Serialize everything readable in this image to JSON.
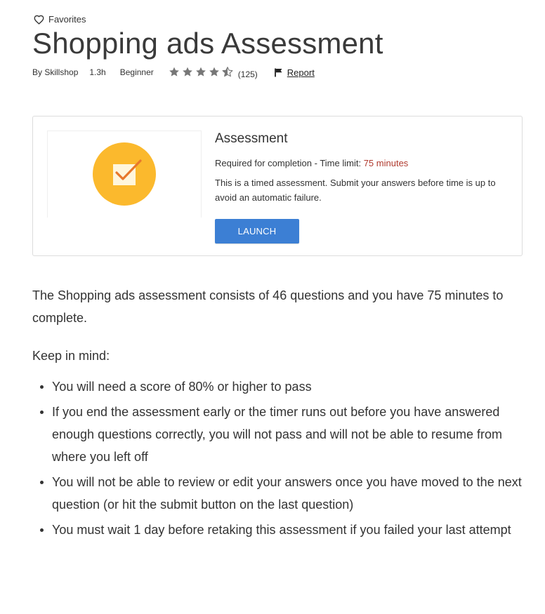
{
  "favorites": {
    "label": "Favorites",
    "icon": "heart-outline-icon"
  },
  "header": {
    "title": "Shopping ads Assessment",
    "author": "By Skillshop",
    "duration": "1.3h",
    "level": "Beginner",
    "rating": 4.5,
    "rating_max": 5,
    "rating_count": "(125)",
    "report_label": "Report",
    "report_icon": "flag-icon"
  },
  "card": {
    "icon": "checkbox-badge-icon",
    "icon_colors": {
      "circle": "#FBB92D",
      "box": "#FFF6DC",
      "check": "#E8782B"
    },
    "title": "Assessment",
    "requirement_text": "Required for completion - Time limit:",
    "time_limit": "75 minutes",
    "description": "This is a timed assessment. Submit your answers before time is up to avoid an automatic failure.",
    "launch_label": "LAUNCH"
  },
  "content": {
    "intro": "The Shopping ads assessment consists of 46 questions and you have 75 minutes to complete.",
    "keep_in_mind": "Keep in mind:",
    "bullets": [
      "You will need a score of 80% or higher to pass",
      "If you end the assessment early or the timer runs out before you have answered enough questions correctly, you will not pass and will not be able to resume from where you left off",
      "You will not be able to review or edit your answers once you have moved to the next question (or hit the submit button on the last question)",
      "You must wait 1 day before retaking this assessment if you failed your last attempt"
    ]
  },
  "colors": {
    "accent_button": "#3c7fd4",
    "time_limit_text": "#b03a2e",
    "star": "#777777"
  }
}
